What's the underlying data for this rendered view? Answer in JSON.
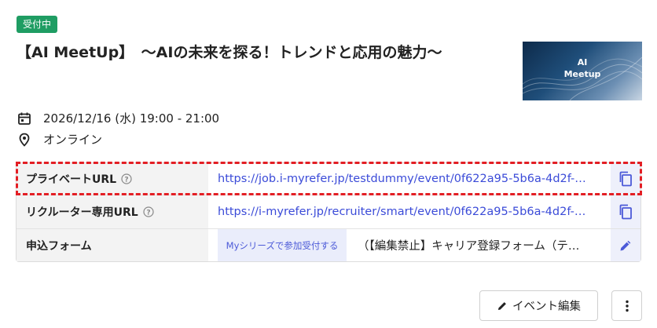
{
  "event": {
    "status_badge": "受付中",
    "title": "【AI MeetUp】　～AIの未来を探る！トレンドと応用の魅力～",
    "thumbnail_text": "AI\nMeetup",
    "datetime": "2026/12/16 (水) 19:00 - 21:00",
    "location": "オンライン"
  },
  "table": {
    "private_url": {
      "label": "プライベートURL",
      "value": "https://job.i-myrefer.jp/testdummy/event/0f622a95-5b6a-4d2f-…"
    },
    "recruiter_url": {
      "label": "リクルーター専用URL",
      "value": "https://i-myrefer.jp/recruiter/smart/event/0f622a95-5b6a-4d2f-…"
    },
    "application_form": {
      "label": "申込フォーム",
      "chip": "Myシリーズで参加受付する",
      "value": "（【編集禁止】キャリア登録フォーム（テ…"
    }
  },
  "actions": {
    "edit_label": "イベント編集"
  },
  "colors": {
    "badge": "#1f9d63",
    "link": "#3b4bd8",
    "highlight": "#e31e24"
  },
  "icons": [
    "calendar-icon",
    "location-pin-icon",
    "help-icon",
    "copy-icon",
    "pencil-icon",
    "more-vertical-icon"
  ]
}
